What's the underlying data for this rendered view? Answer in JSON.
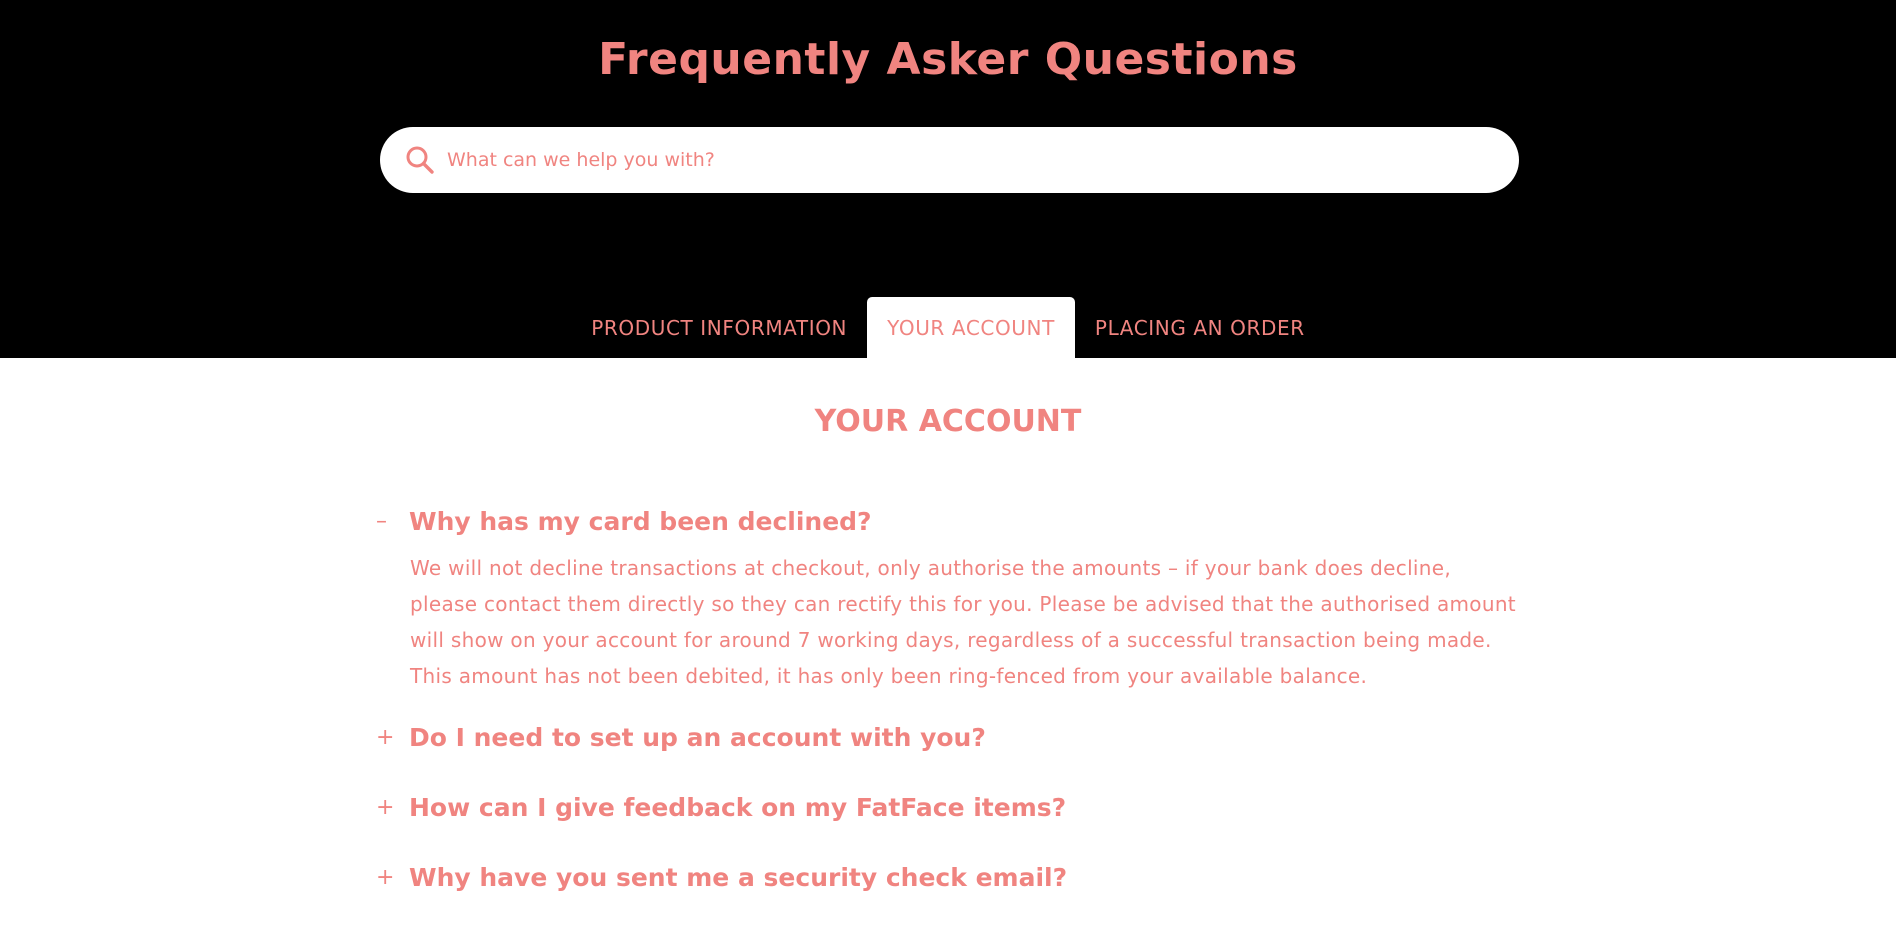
{
  "header": {
    "title": "Frequently Asker Questions"
  },
  "search": {
    "placeholder": "What can we help you with?",
    "icon": "search-icon"
  },
  "tabs": [
    {
      "label": "PRODUCT INFORMATION",
      "active": false
    },
    {
      "label": "YOUR ACCOUNT",
      "active": true
    },
    {
      "label": "PLACING AN ORDER",
      "active": false
    }
  ],
  "section": {
    "title": "YOUR ACCOUNT"
  },
  "faqs": [
    {
      "toggle": "–",
      "question": "Why has my card been declined?",
      "answer": "We will not decline transactions at checkout, only authorise the amounts – if your bank does decline, please contact them directly so they can rectify this for you. Please be advised that the authorised amount will show on your account for around 7 working days, regardless of a successful transaction being made. This amount has not been debited, it has only been ring-fenced from your available balance.",
      "expanded": true
    },
    {
      "toggle": "+",
      "question": "Do I need to set up an account with you?",
      "expanded": false
    },
    {
      "toggle": "+",
      "question": "How can I give feedback on my FatFace items?",
      "expanded": false
    },
    {
      "toggle": "+",
      "question": "Why have you sent me a security check email?",
      "expanded": false
    }
  ],
  "colors": {
    "accent": "#f08480",
    "header_bg": "#000000",
    "page_bg": "#ffffff"
  }
}
